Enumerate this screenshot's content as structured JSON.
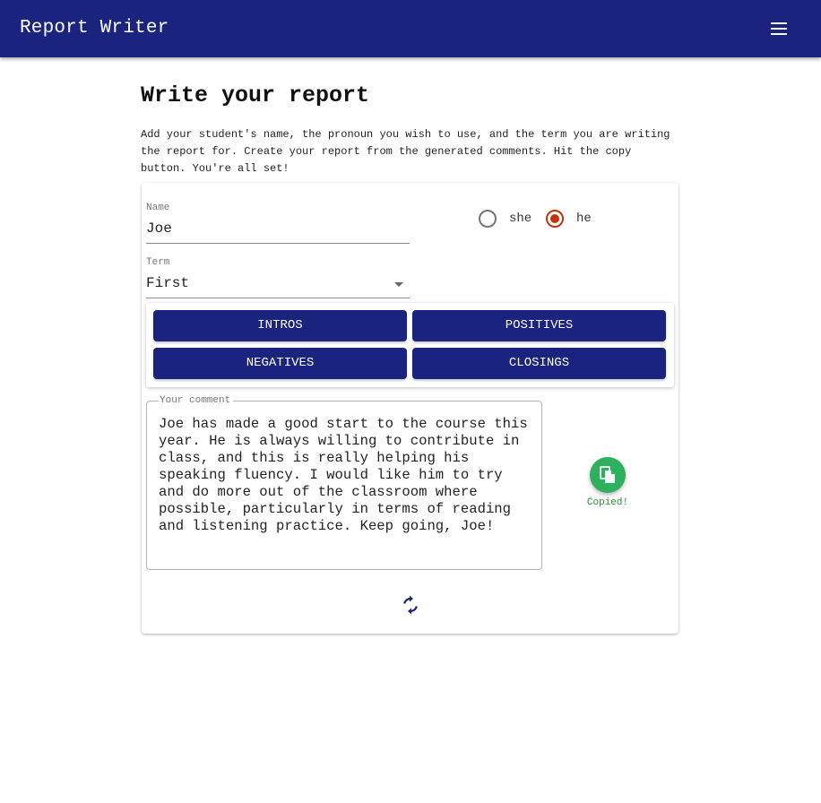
{
  "app": {
    "title": "Report Writer",
    "menu_icon": "menu-icon",
    "brand_color": "#1a237e"
  },
  "page": {
    "title": "Write your report",
    "intro": "Add your student's name, the pronoun you wish to use, and the term you are writing the report for. Create your report from the generated comments. Hit the copy button. You're all set!"
  },
  "form": {
    "name_label": "Name",
    "name_value": "Joe",
    "term_label": "Term",
    "term_value": "First",
    "pronouns": [
      {
        "label": "she",
        "selected": false
      },
      {
        "label": "he",
        "selected": true
      }
    ],
    "radio_color": "#bf360c"
  },
  "categories": [
    "INTROS",
    "POSITIVES",
    "NEGATIVES",
    "CLOSINGS"
  ],
  "comment": {
    "label": "Your comment",
    "text": "Joe has made a good start to the course this year. He is always willing to contribute in class, and this is really helping his speaking fluency. I would like him to try and do more out of the classroom where possible, particularly in terms of reading and listening practice. Keep going, Joe!"
  },
  "actions": {
    "copy_icon": "copy-icon",
    "copy_status": "Copied!",
    "copy_color": "#2eb05e",
    "refresh_icon": "refresh-icon"
  }
}
